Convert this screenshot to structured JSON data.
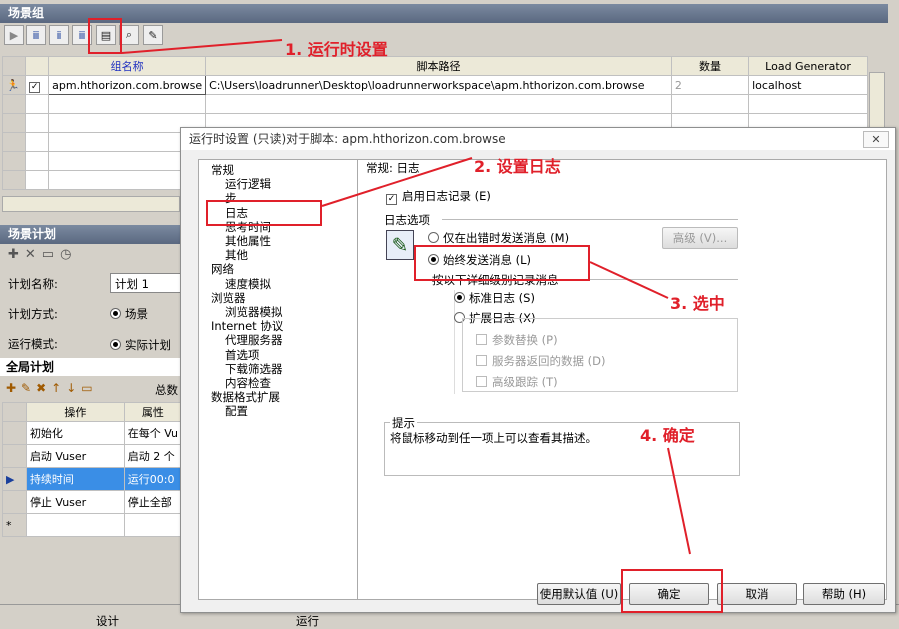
{
  "scenario_group": {
    "title": "场景组",
    "columns": [
      "组名称",
      "脚本路径",
      "数量",
      "Load Generator"
    ],
    "rows": [
      {
        "name": "apm.hthorizon.com.browse",
        "path": "C:\\Users\\loadrunner\\Desktop\\loadrunnerworkspace\\apm.hthorizon.com.browse",
        "qty": "2",
        "lg": "localhost"
      }
    ]
  },
  "scenario_plan": {
    "title": "场景计划",
    "plan_name_label": "计划名称:",
    "plan_name_value": "计划 1",
    "plan_mode_label": "计划方式:",
    "plan_mode_value": "场景",
    "run_mode_label": "运行模式:",
    "run_mode_value": "实际计划"
  },
  "global_plan": {
    "title": "全局计划",
    "total_label": "总数",
    "columns": [
      "操作",
      "属性"
    ],
    "rows": [
      {
        "op": "初始化",
        "attr": "在每个 Vu"
      },
      {
        "op": "启动 Vuser",
        "attr": "启动 2 个"
      },
      {
        "op": "持续时间",
        "attr": "运行00:0"
      },
      {
        "op": "停止 Vuser",
        "attr": "停止全部"
      }
    ],
    "new_row_marker": "*"
  },
  "bottom_tabs": [
    "设计",
    "运行"
  ],
  "dialog": {
    "title": "运行时设置 (只读)对于脚本: apm.hthorizon.com.browse",
    "close": "✕",
    "tree": [
      {
        "label": "常规",
        "level": 0
      },
      {
        "label": "运行逻辑",
        "level": 1
      },
      {
        "label": "步",
        "level": 1
      },
      {
        "label": "日志",
        "level": 1
      },
      {
        "label": "思考时间",
        "level": 1
      },
      {
        "label": "其他属性",
        "level": 1
      },
      {
        "label": "其他",
        "level": 1
      },
      {
        "label": "网络",
        "level": 0
      },
      {
        "label": "速度模拟",
        "level": 1
      },
      {
        "label": "浏览器",
        "level": 0
      },
      {
        "label": "浏览器模拟",
        "level": 1
      },
      {
        "label": "Internet 协议",
        "level": 0
      },
      {
        "label": "代理服务器",
        "level": 1
      },
      {
        "label": "首选项",
        "level": 1
      },
      {
        "label": "下载筛选器",
        "level": 1
      },
      {
        "label": "内容检查",
        "level": 1
      },
      {
        "label": "数据格式扩展",
        "level": 0
      },
      {
        "label": "配置",
        "level": 1
      }
    ],
    "section_title": "常规: 日志",
    "enable_logging": "启用日志记录 (E)",
    "log_options": "日志选项",
    "only_on_error": "仅在出错时发送消息 (M)",
    "advanced": "高级 (V)...",
    "always_send": "始终发送消息 (L)",
    "send_detail_level": "按以下详细级别记录消息",
    "standard_log": "标准日志 (S)",
    "extended_log": "扩展日志 (X)",
    "param_sub": "参数替换 (P)",
    "server_data": "服务器返回的数据 (D)",
    "advanced_trace": "高级跟踪 (T)",
    "hint_title": "提示",
    "hint_text": "将鼠标移动到任一项上可以查看其描述。",
    "btn_default": "使用默认值 (U)",
    "btn_ok": "确定",
    "btn_cancel": "取消",
    "btn_help": "帮助 (H)"
  },
  "annotations": {
    "step1": "1. 运行时设置",
    "step2": "2. 设置日志",
    "step3": "3. 选中",
    "step4": "4. 确定",
    "color": "#e0202a"
  }
}
